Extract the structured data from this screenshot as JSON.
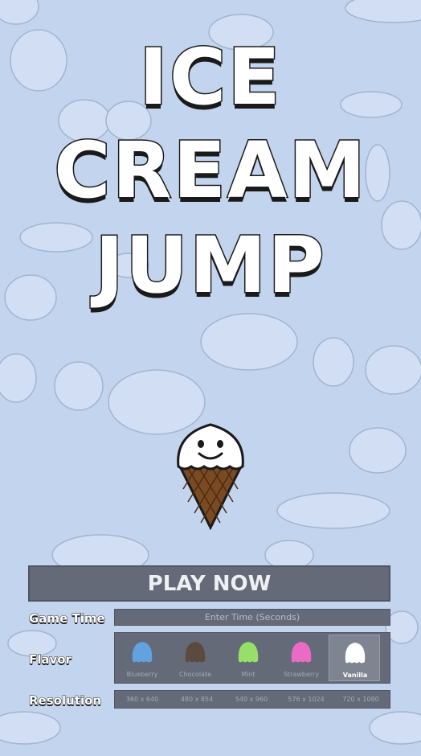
{
  "title": {
    "line1": "ICE",
    "line2": "CREAM",
    "line3": "JUMP"
  },
  "colors": {
    "background": "#c3d4ee",
    "panel": "#646a78",
    "cone": "#7a4a22",
    "scoop": "#ffffff"
  },
  "play_button": {
    "label": "PLAY NOW"
  },
  "game_time": {
    "label": "Game Time",
    "placeholder": "Enter Time (Seconds)",
    "value": ""
  },
  "flavor": {
    "label": "Flavor",
    "selected": "Vanilla",
    "options": [
      {
        "name": "Blueberry",
        "color": "#62a2e0"
      },
      {
        "name": "Chocolate",
        "color": "#5d4a3e"
      },
      {
        "name": "Mint",
        "color": "#96e06a"
      },
      {
        "name": "Strawberry",
        "color": "#ea6ac6"
      },
      {
        "name": "Vanilla",
        "color": "#ffffff"
      }
    ]
  },
  "resolution": {
    "label": "Resolution",
    "options": [
      "360 x 640",
      "480 x 854",
      "540 x 960",
      "576 x 1024",
      "720 x 1080"
    ]
  }
}
